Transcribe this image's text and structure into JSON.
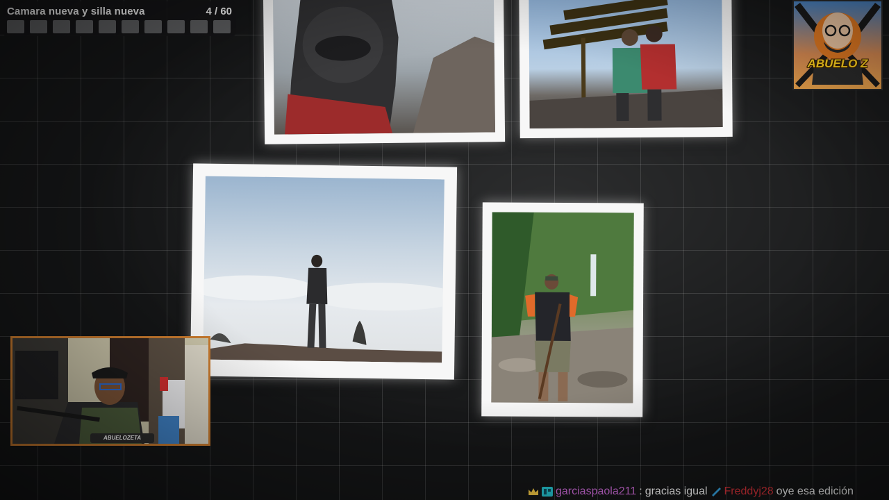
{
  "goal": {
    "title": "Camara nueva y silla nueva",
    "count": "4 / 60",
    "segments": 10
  },
  "logo": {
    "text": "ABUELO Z"
  },
  "webcam": {
    "label": "ABUELOZETA"
  },
  "chat": {
    "messages": [
      {
        "user": "garciaspaola211",
        "text": "gracias igual"
      },
      {
        "user": "Freddyj28",
        "text": "oye esa edición"
      }
    ]
  },
  "colors": {
    "goal_segment": "#5b5c5e",
    "webcam_border": "#c87a2e",
    "user1": "#d16cdc",
    "user2": "#e0343b"
  }
}
